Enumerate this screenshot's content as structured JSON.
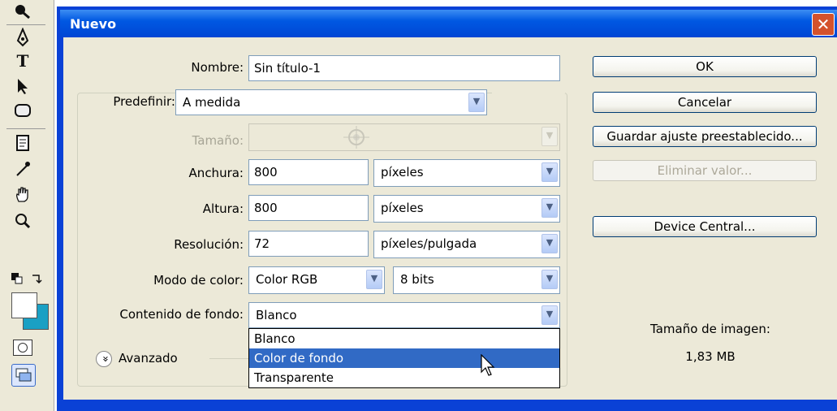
{
  "window": {
    "title": "Nuevo",
    "close_glyph": "✕"
  },
  "toolbox": {
    "tools": [
      "magic-wand-icon",
      "pen-icon",
      "type-icon",
      "path-selection-icon",
      "shape-icon",
      "notes-icon",
      "eyedropper-icon",
      "hand-icon",
      "zoom-icon"
    ],
    "type_glyph": "T",
    "zoom_glyph": "🔍"
  },
  "form": {
    "nombre": {
      "label": "Nombre:",
      "value": "Sin título-1"
    },
    "predefinir": {
      "label": "Predefinir:",
      "value": "A medida"
    },
    "tamano": {
      "label": "Tamaño:"
    },
    "anchura": {
      "label": "Anchura:",
      "value": "800",
      "unit": "píxeles"
    },
    "altura": {
      "label": "Altura:",
      "value": "800",
      "unit": "píxeles"
    },
    "resolucion": {
      "label": "Resolución:",
      "value": "72",
      "unit": "píxeles/pulgada"
    },
    "modo": {
      "label": "Modo de color:",
      "value": "Color RGB",
      "bits": "8 bits"
    },
    "contenido": {
      "label": "Contenido de fondo:",
      "value": "Blanco",
      "options": [
        "Blanco",
        "Color de fondo",
        "Transparente"
      ],
      "highlighted": 1
    },
    "avanzado": {
      "label": "Avanzado",
      "glyph": "»"
    }
  },
  "buttons": {
    "ok": "OK",
    "cancel": "Cancelar",
    "save_preset": "Guardar ajuste preestablecido...",
    "delete_preset": "Eliminar valor...",
    "device_central": "Device Central..."
  },
  "info": {
    "label": "Tamaño de imagen:",
    "value": "1,83 MB"
  },
  "colors": {
    "title_bar": "#0058e2",
    "dialog_bg": "#ece9d8",
    "highlight": "#316ac5",
    "arrow_annotation": "#9b1c1c",
    "foreground_swatch": "#ffffff",
    "background_swatch": "#1aa0c4"
  }
}
